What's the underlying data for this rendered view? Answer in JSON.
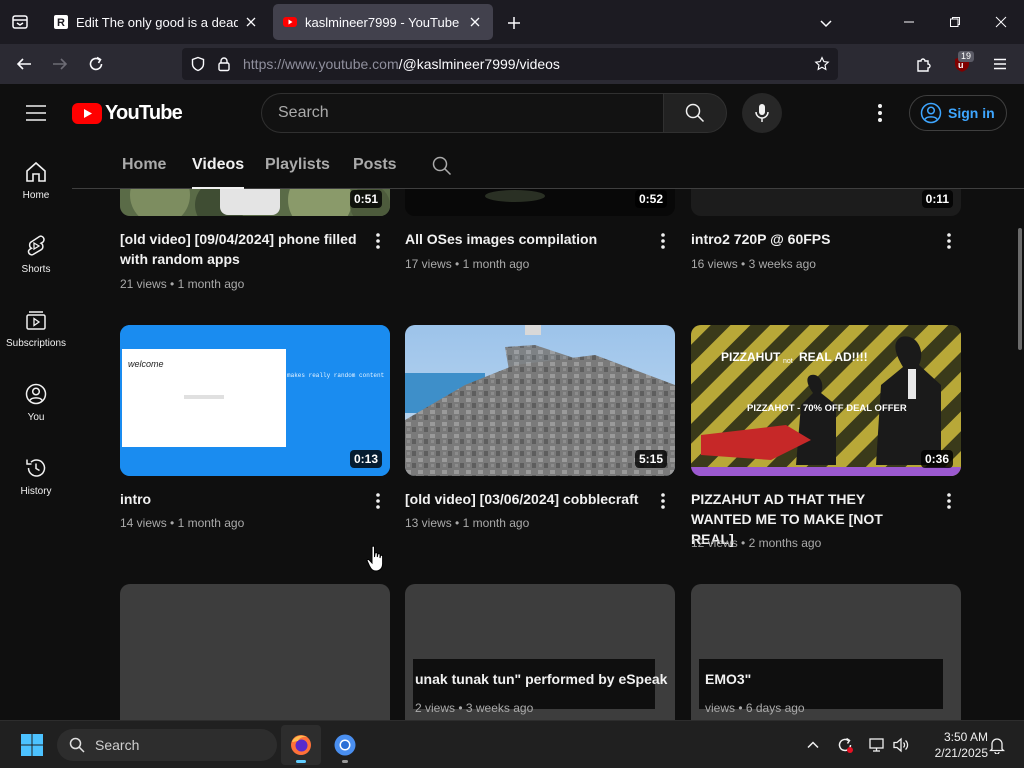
{
  "browser": {
    "tabs": [
      {
        "title": "Edit The only good is a dead on",
        "active": false
      },
      {
        "title": "kaslmineer7999 - YouTube",
        "active": true
      }
    ],
    "url_host": "https://www.youtube.com",
    "url_path": "/@kaslmineer7999/videos",
    "extension_badge": "19"
  },
  "youtube": {
    "logo_text": "YouTube",
    "search_placeholder": "Search",
    "signin_label": "Sign in",
    "guide": [
      {
        "label": "Home",
        "icon": "home-icon"
      },
      {
        "label": "Shorts",
        "icon": "shorts-icon"
      },
      {
        "label": "Subscriptions",
        "icon": "subscriptions-icon"
      },
      {
        "label": "You",
        "icon": "you-icon"
      },
      {
        "label": "History",
        "icon": "history-icon"
      }
    ],
    "channel_tabs": [
      {
        "label": "Home",
        "selected": false
      },
      {
        "label": "Videos",
        "selected": true
      },
      {
        "label": "Playlists",
        "selected": false
      },
      {
        "label": "Posts",
        "selected": false
      }
    ],
    "videos": [
      {
        "title": "[old video] [09/04/2024] phone filled with random apps",
        "views": "21 views",
        "age": "1 month ago",
        "duration": "0:51"
      },
      {
        "title": "All OSes images compilation",
        "views": "17 views",
        "age": "1 month ago",
        "duration": "0:52"
      },
      {
        "title": "intro2 720P @ 60FPS",
        "views": "16 views",
        "age": "3 weeks ago",
        "duration": "0:11"
      },
      {
        "title": "intro",
        "views": "14 views",
        "age": "1 month ago",
        "duration": "0:13",
        "thumb_text": [
          "welcome",
          "makes really random content"
        ]
      },
      {
        "title": "[old video] [03/06/2024] cobblecraft",
        "views": "13 views",
        "age": "1 month ago",
        "duration": "5:15"
      },
      {
        "title": "PIZZAHUT AD THAT THEY WANTED ME TO MAKE [NOT REAL]",
        "views": "12 views",
        "age": "2 months ago",
        "duration": "0:36",
        "thumb_text": [
          "PIZZAHUT",
          "not",
          "REAL AD!!!!",
          "PIZZAHOT - 70% OFF DEAL OFFER"
        ]
      },
      {
        "title_fragment": "unak tunak tun\" performed by eSpeak",
        "meta_fragment": "2 views • 3 weeks ago"
      },
      {
        "title_fragment": "EMO3\"",
        "meta_fragment": "views • 6 days ago"
      }
    ]
  },
  "taskbar": {
    "search_label": "Search",
    "time": "3:50 AM",
    "date": "2/21/2025"
  }
}
